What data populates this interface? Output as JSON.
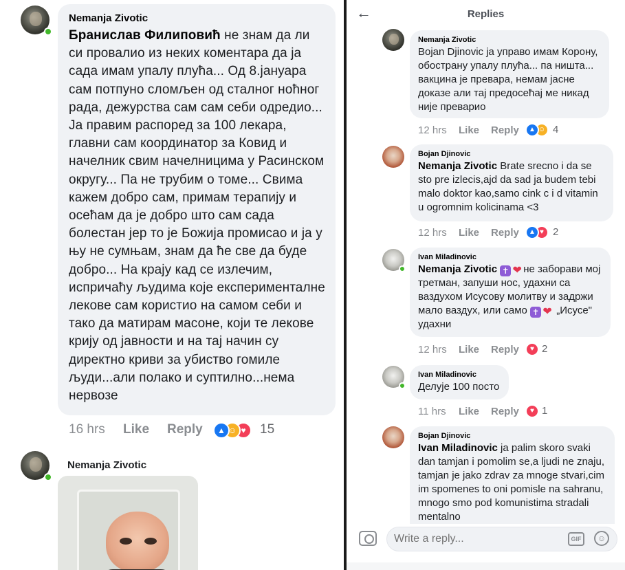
{
  "left": {
    "comment1": {
      "author": "Nemanja Zivotic",
      "tag": "Бранислав Филиповић",
      "text": " не знам да ли си провалио из неких коментара да ја сада имам упалу плућа... Од 8.јануара сам потпуно сломљен од сталног ноћног рада, дежурства сам сам себи одредио... Ја правим распоред за 100 лекара, главни сам координатор за Ковид и начелник свим начелницима у Расинском округу... Па не трубим о томе... Свима кажем добро сам, примам терапију и осећам да је добро што сам сада болестан јер то је Божија промисао и ја у њу не сумњам, знам да ће све да буде добро... На крају кад се излечим, испричаћу људима које експерименталне лекове сам користио на самом себи и тако да матирам масоне, који те лекове крију од јавности и на тај начин су директно криви за убиство гомиле људи...али полако и суптилно...нема нервозе",
      "time": "16 hrs",
      "like": "Like",
      "reply": "Reply",
      "reaction_count": "15",
      "reactions": [
        "like",
        "care",
        "love"
      ]
    },
    "comment2": {
      "author": "Nemanja Zivotic"
    }
  },
  "right": {
    "header": {
      "back_icon": "arrow-left-icon",
      "title": "Replies"
    },
    "replies": [
      {
        "author": "Nemanja Zivotic",
        "tag": "",
        "text": "Bojan Djinovic ја управо имам Корону, обострану упалу плућа... па ништа... вакцина је превара, немам јасне доказе али тај предосећај ме никад није преварио",
        "time": "12 hrs",
        "like": "Like",
        "reply": "Reply",
        "reaction_count": "4",
        "reactions": [
          "like",
          "care"
        ]
      },
      {
        "author": "Bojan Djinovic",
        "tag": "Nemanja Zivotic",
        "text": " Brate srecno i da se sto pre izlecis,ajd da sad ja budem tebi malo doktor kao,samo cink c i d vitamin u ogromnim kolicinama <3",
        "time": "12 hrs",
        "like": "Like",
        "reply": "Reply",
        "reaction_count": "2",
        "reactions": [
          "like",
          "love"
        ]
      },
      {
        "author": "Ivan Miladinovic",
        "tag": "Nemanja Zivotic",
        "text_a": "не заборави мој третман, запуши нос, удахни са ваздухом Исусову молитву и задржи мало ваздух, или само",
        "text_b": "„Исусе\" удахни",
        "time": "12 hrs",
        "like": "Like",
        "reply": "Reply",
        "reaction_count": "2",
        "reactions": [
          "love"
        ]
      },
      {
        "author": "Ivan Miladinovic",
        "tag": "",
        "text": "Делује 100 посто",
        "time": "11 hrs",
        "like": "Like",
        "reply": "Reply",
        "reaction_count": "1",
        "reactions": [
          "love"
        ]
      },
      {
        "author": "Bojan Djinovic",
        "tag": "Ivan Miladinovic",
        "text": " ja palim skoro svaki dan tamjan i pomolim se,a ljudi ne znaju, tamjan je jako zdrav za mnoge stvari,cim im spomenes to oni pomisle na sahranu, mnogo smo pod komunistima stradali mentalno"
      }
    ],
    "composer": {
      "placeholder": "Write a reply...",
      "gif_label": "GIF",
      "camera_icon": "camera-icon",
      "emoji_icon": "smile-icon"
    }
  },
  "colors": {
    "bubble": "#f0f2f5",
    "like": "#1877f2",
    "love": "#f33e58",
    "care": "#f7b125",
    "online": "#42b72a",
    "meta": "#8a8d91"
  }
}
